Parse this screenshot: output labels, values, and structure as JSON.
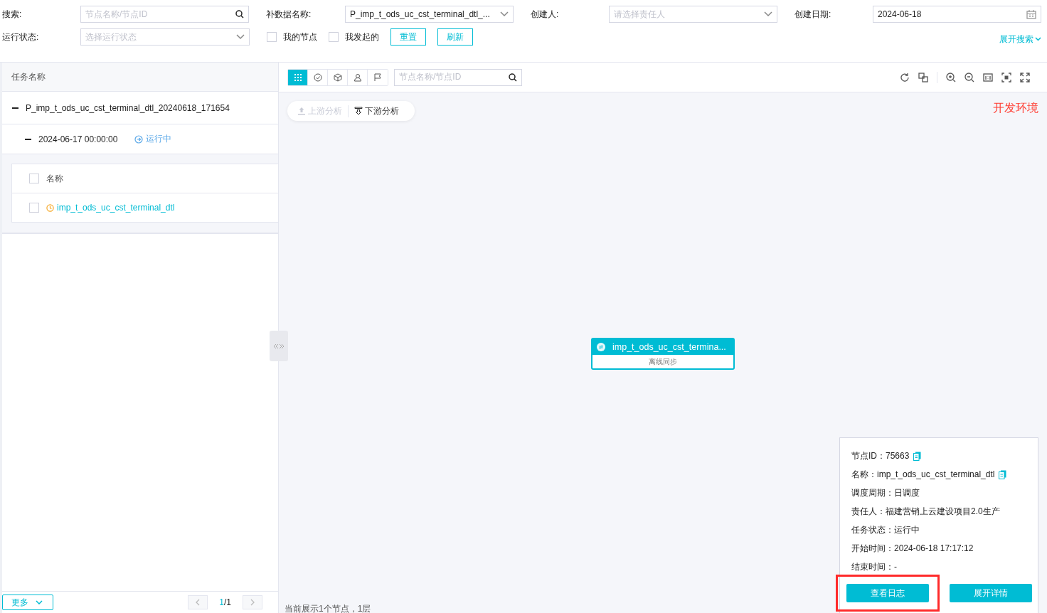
{
  "filters": {
    "search": {
      "label": "搜索:",
      "placeholder": "节点名称/节点ID"
    },
    "fill_name": {
      "label": "补数据名称:",
      "value": "P_imp_t_ods_uc_cst_terminal_dtl_..."
    },
    "creator": {
      "label": "创建人:",
      "placeholder": "请选择责任人"
    },
    "create_date": {
      "label": "创建日期:",
      "value": "2024-06-18"
    },
    "run_status": {
      "label": "运行状态:",
      "placeholder": "选择运行状态"
    },
    "checkboxes": [
      {
        "label": "我的节点",
        "checked": false
      },
      {
        "label": "我发起的",
        "checked": false
      }
    ],
    "buttons": [
      "重置",
      "刷新"
    ],
    "expand_link": "展开搜索"
  },
  "task_panel": {
    "header": "任务名称",
    "tree": [
      {
        "label": "P_imp_t_ods_uc_cst_terminal_dtl_20240618_171654",
        "expanded": true,
        "children": [
          {
            "label": "2024-06-17 00:00:00",
            "status": "运行中",
            "expanded": true
          }
        ]
      }
    ],
    "table": {
      "column": "名称",
      "header_checked": false,
      "rows": [
        {
          "name": "imp_t_ods_uc_cst_terminal_dtl",
          "checked": false
        }
      ]
    },
    "more_button": "更多",
    "pager": {
      "current": "1",
      "total": "/1"
    }
  },
  "canvas": {
    "view_tabs": [
      {
        "kind": "grid",
        "selected": true
      },
      {
        "kind": "check",
        "selected": false
      },
      {
        "kind": "cube",
        "selected": false
      },
      {
        "kind": "user",
        "selected": false
      },
      {
        "kind": "flag",
        "selected": false
      }
    ],
    "search_placeholder": "节点名称/节点ID",
    "analysis": [
      {
        "label": "上游分析",
        "disabled": true
      },
      {
        "label": "下游分析",
        "disabled": false
      }
    ],
    "env": "开发环境",
    "node": {
      "name": "imp_t_ods_uc_cst_termina...",
      "type": "离线同步"
    },
    "status": "当前展示1个节点，1层"
  },
  "details": {
    "rows": [
      {
        "text": "节点ID：75663",
        "copyable": true
      },
      {
        "text": "名称：imp_t_ods_uc_cst_terminal_dtl",
        "copyable": true
      },
      {
        "text": "调度周期：日调度",
        "copyable": false
      },
      {
        "text": "责任人：福建营销上云建设项目2.0生产",
        "copyable": false
      },
      {
        "text": "任务状态：运行中",
        "copyable": false
      },
      {
        "text": "开始时间：2024-06-18 17:17:12",
        "copyable": false
      },
      {
        "text": "结束时间：-",
        "copyable": false
      }
    ],
    "buttons": [
      {
        "label": "查看日志",
        "highlighted": true
      },
      {
        "label": "展开详情",
        "highlighted": false
      }
    ]
  }
}
